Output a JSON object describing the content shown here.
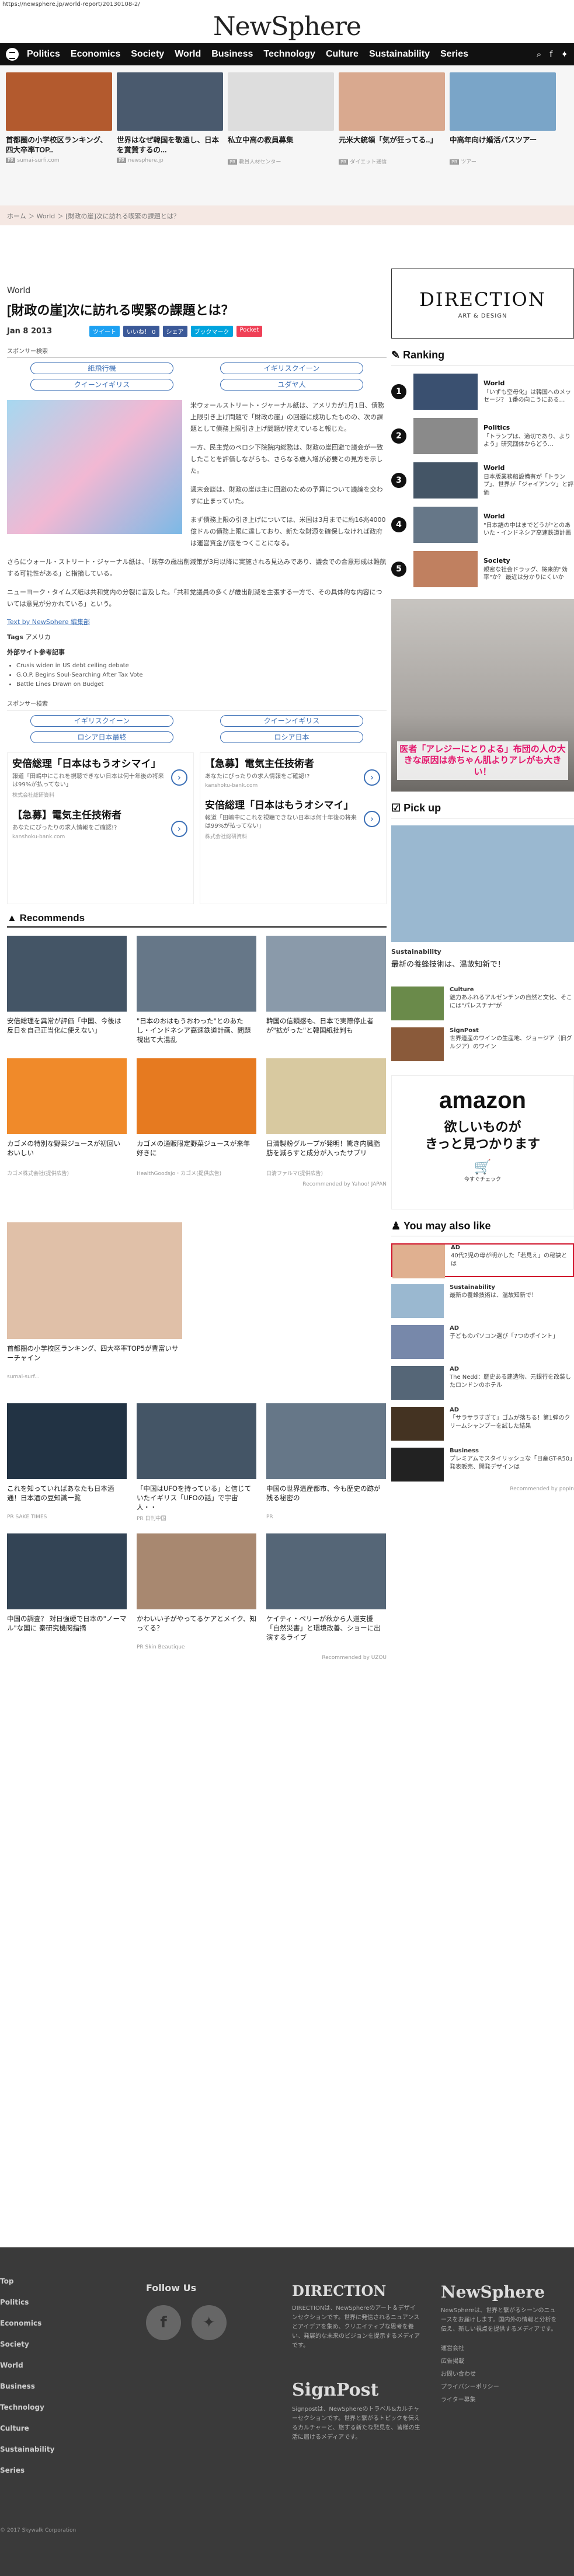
{
  "url": "https://newsphere.jp/world-report/20130108-2/",
  "site": {
    "logo": "NewSphere"
  },
  "nav": {
    "items": [
      "Politics",
      "Economics",
      "Society",
      "World",
      "Business",
      "Technology",
      "Culture",
      "Sustainability",
      "Series"
    ]
  },
  "strip": [
    {
      "title": "首都圏の小学校区ランキング、四大卒率TOP..",
      "src": "sumai-surfi.com",
      "color": "#b35a2e"
    },
    {
      "title": "世界はなぜ韓国を敬遠し、日本を賞賛するの...",
      "src": "newsphere.jp",
      "color": "#4a5a6e"
    },
    {
      "title": "私立中高の教員募集",
      "src": "教員人材センター",
      "color": "#ddd"
    },
    {
      "title": "元米大統領「気が狂ってる..」",
      "src": "ダイエット通信",
      "color": "#d9a98f"
    },
    {
      "title": "中高年向け婚活パスツアー",
      "src": "ツアー",
      "color": "#7aa5c8"
    }
  ],
  "breadcrumb": "ホーム ＞ World ＞ [財政の崖]次に訪れる喫緊の課題とは？",
  "article": {
    "category": "World",
    "title": "[財政の崖]次に訪れる喫緊の課題とは？",
    "date": "Jan 8 2013",
    "share": [
      "ツイート",
      "いいね！ 0",
      "シェア",
      "ブックマーク",
      "Pocket"
    ],
    "sponsor": "スポンサー検索",
    "pills": [
      "紙飛行機",
      "イギリスクイーン",
      "クイーンイギリス",
      "ユダヤ人"
    ],
    "paras": [
      "米ウォールストリート・ジャーナル紙は、アメリカが1月1日、債務上限引き上げ問題で「財政の崖」の回避に成功したものの、次の課題として債務上限引き上げ問題が控えていると報じた。",
      "一方、民主党のペロシ下院院内総務は、財政の崖回避で議会が一致したことを評価しながらも、さらなる歳入増が必要との見方を示した。",
      "週末会談は、財政の崖は主に回避のための予算について議論を交わすに止まっていた。",
      "まず債務上限の引き上げについては、米国は3月までに約16兆4000億ドルの債務上限に達しており、新たな財源を確保しなければ政府は運営資金が底をつくことになる。",
      "さらにウォール・ストリート・ジャーナル紙は、「既存の歳出削減策が3月以降に実施される見込みであり、議会での合意形成は難航する可能性がある」と指摘している。",
      "ニューヨーク・タイムズ紙は共和党内の分裂に言及した。「共和党議員の多くが歳出削減を主張する一方で、その具体的な内容については意見が分かれている」という。"
    ],
    "source_label": "Text by NewSphere 編集部",
    "tags_label": "Tags",
    "tag": "アメリカ",
    "refs_title": "外部サイト参考記事",
    "refs": [
      "Crusis widen in US debt ceiling debate",
      "G.O.P. Begins Soul-Searching After Tax Vote",
      "Battle Lines Drawn on Budget"
    ],
    "pills2": [
      "イギリスクイーン",
      "クイーンイギリス",
      "ロシア日本最終",
      "ロシア日本"
    ]
  },
  "ads2": [
    {
      "h": "安倍総理「日本はもうオシマイ」",
      "d": "報道「田嶋中にこれを視聴できない日本は何十年後の将来は99%が払ってない」",
      "u": "株式会社総研資料"
    },
    {
      "h": "【急募】電気主任技術者",
      "d": "あなたにぴったりの求人情報をご確認!?",
      "u": "kanshoku-bank.com"
    },
    {
      "h": "【急募】電気主任技術者",
      "d": "あなたにぴったりの求人情報をご確認!?",
      "u": "kanshoku-bank.com"
    },
    {
      "h": "安倍総理「日本はもうオシマイ」",
      "d": "報道「田嶋中にこれを視聴できない日本は何十年後の将来は99%が払ってない」",
      "u": "株式会社総研資料"
    }
  ],
  "recommend": {
    "title": "Recommends",
    "items": [
      {
        "t": "安倍総理を異常が評価「中国、今後は反日を自己正当化に使えない」",
        "s": "",
        "c": "#445566"
      },
      {
        "t": "\"日本のおはもうおわった\"とのあたし・インドネシア高速鉄道計画、問題視出て大混乱",
        "s": "",
        "c": "#667788"
      },
      {
        "t": "韓国の信頼感も、日本で実際停止者が\"拡がった\"と韓国紙批判も",
        "s": "",
        "c": "#8a9aaa"
      },
      {
        "t": "カゴメの特別な野菜ジュースが初回いおいしい",
        "s": "カゴメ株式会社(提供広告)",
        "c": "#f08a2a"
      },
      {
        "t": "カゴメの通販限定野菜ジュースが来年好きに",
        "s": "HealthGoodsJo・カゴメ(提供広告)",
        "c": "#e67a20"
      },
      {
        "t": "日清製粉グループが発明！驚き内臓脂肪を減らすと成分が入ったサプリ",
        "s": "日清ファルマ(提供広告)",
        "c": "#d8c9a0"
      }
    ],
    "credit": "Recommended by Yahoo! JAPAN"
  },
  "single": {
    "t": "首都圏の小学校区ランキング、四大卒率TOP5が豊富いサーチャイン",
    "s": "sumai-surf...",
    "c": "#e0c0a8"
  },
  "moreitems": [
    {
      "t": "これを知っていればあなたも日本酒通！日本酒の豆知識一覧",
      "s": "PR SAKE TIMES",
      "c": "#223344"
    },
    {
      "t": "「中国はUFOを持っている」と信じていたイギリス「UFOの話」で宇宙人・・",
      "s": "PR 日刊中国",
      "c": "#445566"
    },
    {
      "t": "中国の世界遺産都市、今も歴史の跡が残る秘密の",
      "s": "PR",
      "c": "#667788"
    },
    {
      "t": "中国の調査？ 対日強硬で日本の\"ノーマル\"な国に 秦研究機関指摘",
      "s": "",
      "c": "#334455"
    },
    {
      "t": "かわいい子がやってるケアとメイク、知ってる？",
      "s": "PR Skin Beautique",
      "c": "#a88870"
    },
    {
      "t": "ケイティ・ペリーが秋から人道支援「自然災害」と環境改善、ショーに出演するライブ",
      "s": "",
      "c": "#556677"
    }
  ],
  "uzou": "Recommended by UZOU",
  "sidebar": {
    "direction": {
      "title": "DIRECTION",
      "sub": "ART & DESIGN"
    },
    "ranking_title": "Ranking",
    "ranking": [
      {
        "n": "1",
        "c": "World",
        "t": "「いずも空母化」は韓国へのメッセージ？ 1番の向こうにある…",
        "color": "#3a5070"
      },
      {
        "n": "2",
        "c": "Politics",
        "t": "「トランプは、適切であり、よりよう」研究団体からどう…",
        "color": "#8a8a8a"
      },
      {
        "n": "3",
        "c": "World",
        "t": "日本版業務船設備有が「トランプ」、世界が「ジャイアンツ」と評価",
        "color": "#445566"
      },
      {
        "n": "4",
        "c": "World",
        "t": "\"日本語の中はまでどうが\"とのあいた・インドネシア高速鉄道計画",
        "color": "#667788"
      },
      {
        "n": "5",
        "c": "Society",
        "t": "親密な社会ドラッグ、将来的\"効率\"か？ 最近は分かりにくいか",
        "color": "#c08060"
      }
    ],
    "sidead": "医者「アレジーにとりよる」布団の人の大きな原因は赤ちゃん肌よりアレがも大きい！",
    "pickup_title": "Pick up",
    "pick_main": {
      "c": "Sustainability",
      "t": "最新の養蜂技術は、温故知新で！",
      "color": "#9ab8d0"
    },
    "pick_minis": [
      {
        "c": "Culture",
        "t": "魅力あふれるアルゼンチンの自然と文化、そこには\"パレスチナ\"が",
        "color": "#6a8a4a"
      },
      {
        "c": "SignPost",
        "t": "世界遺産のワインの生産地、ジョージア（旧グルジア）のワイン",
        "color": "#8a5a3a"
      }
    ],
    "amazon": {
      "brand": "amazon",
      "tag": "欲しいものが\nきっと見つかります",
      "shop": "今すぐチェック"
    },
    "ymal_title": "You may also like",
    "ymal": [
      {
        "c": "AD",
        "t": "40代2児の母が明かした「若見え」の秘訣とは",
        "color": "#e0b090",
        "hl": true
      },
      {
        "c": "Sustainability",
        "t": "最新の養蜂技術は、温故知新で！",
        "color": "#9ab8d0"
      },
      {
        "c": "AD",
        "t": "子どものパソコン選び「7つのポイント」",
        "color": "#7788aa"
      },
      {
        "c": "AD",
        "t": "The Nedd：歴史ある建造物、元銀行を改装したロンドンのホテル",
        "color": "#556677"
      },
      {
        "c": "AD",
        "t": "「サラサラすぎて」ゴムが落ちる！第1弾のクリームシャンプーを試した結果",
        "color": "#443322"
      },
      {
        "c": "Business",
        "t": "プレミアムでスタイリッシュな「日産GT-R50」発表販売、開発デザインは",
        "color": "#222222"
      }
    ],
    "ymal_credit": "Recommended by popIn"
  },
  "footer": {
    "links": [
      "Top",
      "Politics",
      "Economics",
      "Society",
      "World",
      "Business",
      "Technology",
      "Culture",
      "Sustainability",
      "Series"
    ],
    "follow": "Follow Us",
    "direction": {
      "h": "DIRECTION",
      "t": "DIRECTIONは、NewSphereのアート＆デザインセクションです。世界に発信されるニュアンスとアイデアを集め、クリエイティブな思考を養い、発展的な未来のビジョンを提示するメディアです。"
    },
    "signpost": {
      "h": "SignPost",
      "t": "Signpostは、NewSphereのトラベル&カルチャーセクションです。世界と繋がるトピックを伝えるカルチャーと、旅する新たな発見を、皆様の生活に届けるメディアです。"
    },
    "ns": {
      "h": "NewSphere",
      "t": "NewSphereは、世界と繋がるシーンのニュースをお届けします。国内外の情報と分析を伝え、新しい視点を提供するメディアです。",
      "links": [
        "運営会社",
        "広告掲載",
        "お問い合わせ",
        "プライバシーポリシー",
        "ライター募集"
      ]
    },
    "copyright": "© 2017 Skywalk Corporation"
  }
}
